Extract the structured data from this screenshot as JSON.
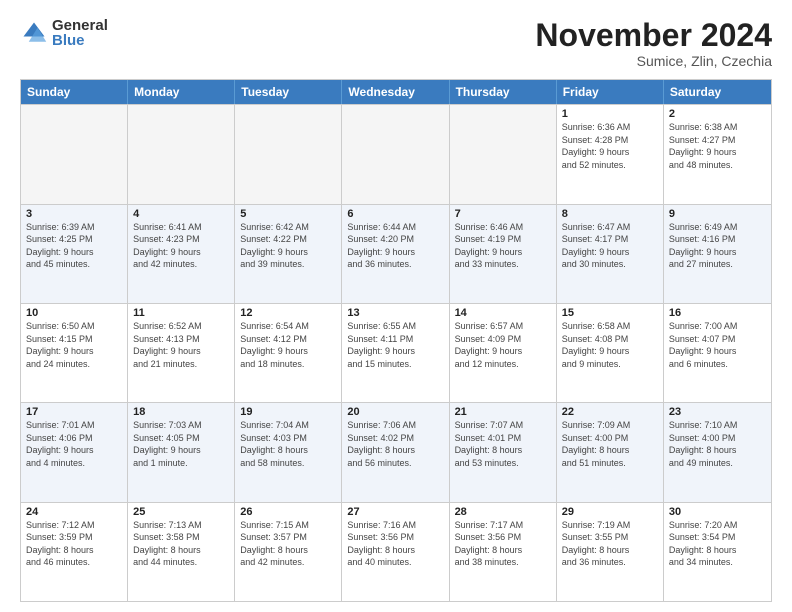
{
  "logo": {
    "general": "General",
    "blue": "Blue"
  },
  "title": "November 2024",
  "subtitle": "Sumice, Zlin, Czechia",
  "days_of_week": [
    "Sunday",
    "Monday",
    "Tuesday",
    "Wednesday",
    "Thursday",
    "Friday",
    "Saturday"
  ],
  "weeks": [
    [
      {
        "day": "",
        "info": "",
        "empty": true
      },
      {
        "day": "",
        "info": "",
        "empty": true
      },
      {
        "day": "",
        "info": "",
        "empty": true
      },
      {
        "day": "",
        "info": "",
        "empty": true
      },
      {
        "day": "",
        "info": "",
        "empty": true
      },
      {
        "day": "1",
        "info": "Sunrise: 6:36 AM\nSunset: 4:28 PM\nDaylight: 9 hours\nand 52 minutes.",
        "empty": false
      },
      {
        "day": "2",
        "info": "Sunrise: 6:38 AM\nSunset: 4:27 PM\nDaylight: 9 hours\nand 48 minutes.",
        "empty": false
      }
    ],
    [
      {
        "day": "3",
        "info": "Sunrise: 6:39 AM\nSunset: 4:25 PM\nDaylight: 9 hours\nand 45 minutes.",
        "empty": false
      },
      {
        "day": "4",
        "info": "Sunrise: 6:41 AM\nSunset: 4:23 PM\nDaylight: 9 hours\nand 42 minutes.",
        "empty": false
      },
      {
        "day": "5",
        "info": "Sunrise: 6:42 AM\nSunset: 4:22 PM\nDaylight: 9 hours\nand 39 minutes.",
        "empty": false
      },
      {
        "day": "6",
        "info": "Sunrise: 6:44 AM\nSunset: 4:20 PM\nDaylight: 9 hours\nand 36 minutes.",
        "empty": false
      },
      {
        "day": "7",
        "info": "Sunrise: 6:46 AM\nSunset: 4:19 PM\nDaylight: 9 hours\nand 33 minutes.",
        "empty": false
      },
      {
        "day": "8",
        "info": "Sunrise: 6:47 AM\nSunset: 4:17 PM\nDaylight: 9 hours\nand 30 minutes.",
        "empty": false
      },
      {
        "day": "9",
        "info": "Sunrise: 6:49 AM\nSunset: 4:16 PM\nDaylight: 9 hours\nand 27 minutes.",
        "empty": false
      }
    ],
    [
      {
        "day": "10",
        "info": "Sunrise: 6:50 AM\nSunset: 4:15 PM\nDaylight: 9 hours\nand 24 minutes.",
        "empty": false
      },
      {
        "day": "11",
        "info": "Sunrise: 6:52 AM\nSunset: 4:13 PM\nDaylight: 9 hours\nand 21 minutes.",
        "empty": false
      },
      {
        "day": "12",
        "info": "Sunrise: 6:54 AM\nSunset: 4:12 PM\nDaylight: 9 hours\nand 18 minutes.",
        "empty": false
      },
      {
        "day": "13",
        "info": "Sunrise: 6:55 AM\nSunset: 4:11 PM\nDaylight: 9 hours\nand 15 minutes.",
        "empty": false
      },
      {
        "day": "14",
        "info": "Sunrise: 6:57 AM\nSunset: 4:09 PM\nDaylight: 9 hours\nand 12 minutes.",
        "empty": false
      },
      {
        "day": "15",
        "info": "Sunrise: 6:58 AM\nSunset: 4:08 PM\nDaylight: 9 hours\nand 9 minutes.",
        "empty": false
      },
      {
        "day": "16",
        "info": "Sunrise: 7:00 AM\nSunset: 4:07 PM\nDaylight: 9 hours\nand 6 minutes.",
        "empty": false
      }
    ],
    [
      {
        "day": "17",
        "info": "Sunrise: 7:01 AM\nSunset: 4:06 PM\nDaylight: 9 hours\nand 4 minutes.",
        "empty": false
      },
      {
        "day": "18",
        "info": "Sunrise: 7:03 AM\nSunset: 4:05 PM\nDaylight: 9 hours\nand 1 minute.",
        "empty": false
      },
      {
        "day": "19",
        "info": "Sunrise: 7:04 AM\nSunset: 4:03 PM\nDaylight: 8 hours\nand 58 minutes.",
        "empty": false
      },
      {
        "day": "20",
        "info": "Sunrise: 7:06 AM\nSunset: 4:02 PM\nDaylight: 8 hours\nand 56 minutes.",
        "empty": false
      },
      {
        "day": "21",
        "info": "Sunrise: 7:07 AM\nSunset: 4:01 PM\nDaylight: 8 hours\nand 53 minutes.",
        "empty": false
      },
      {
        "day": "22",
        "info": "Sunrise: 7:09 AM\nSunset: 4:00 PM\nDaylight: 8 hours\nand 51 minutes.",
        "empty": false
      },
      {
        "day": "23",
        "info": "Sunrise: 7:10 AM\nSunset: 4:00 PM\nDaylight: 8 hours\nand 49 minutes.",
        "empty": false
      }
    ],
    [
      {
        "day": "24",
        "info": "Sunrise: 7:12 AM\nSunset: 3:59 PM\nDaylight: 8 hours\nand 46 minutes.",
        "empty": false
      },
      {
        "day": "25",
        "info": "Sunrise: 7:13 AM\nSunset: 3:58 PM\nDaylight: 8 hours\nand 44 minutes.",
        "empty": false
      },
      {
        "day": "26",
        "info": "Sunrise: 7:15 AM\nSunset: 3:57 PM\nDaylight: 8 hours\nand 42 minutes.",
        "empty": false
      },
      {
        "day": "27",
        "info": "Sunrise: 7:16 AM\nSunset: 3:56 PM\nDaylight: 8 hours\nand 40 minutes.",
        "empty": false
      },
      {
        "day": "28",
        "info": "Sunrise: 7:17 AM\nSunset: 3:56 PM\nDaylight: 8 hours\nand 38 minutes.",
        "empty": false
      },
      {
        "day": "29",
        "info": "Sunrise: 7:19 AM\nSunset: 3:55 PM\nDaylight: 8 hours\nand 36 minutes.",
        "empty": false
      },
      {
        "day": "30",
        "info": "Sunrise: 7:20 AM\nSunset: 3:54 PM\nDaylight: 8 hours\nand 34 minutes.",
        "empty": false
      }
    ]
  ]
}
